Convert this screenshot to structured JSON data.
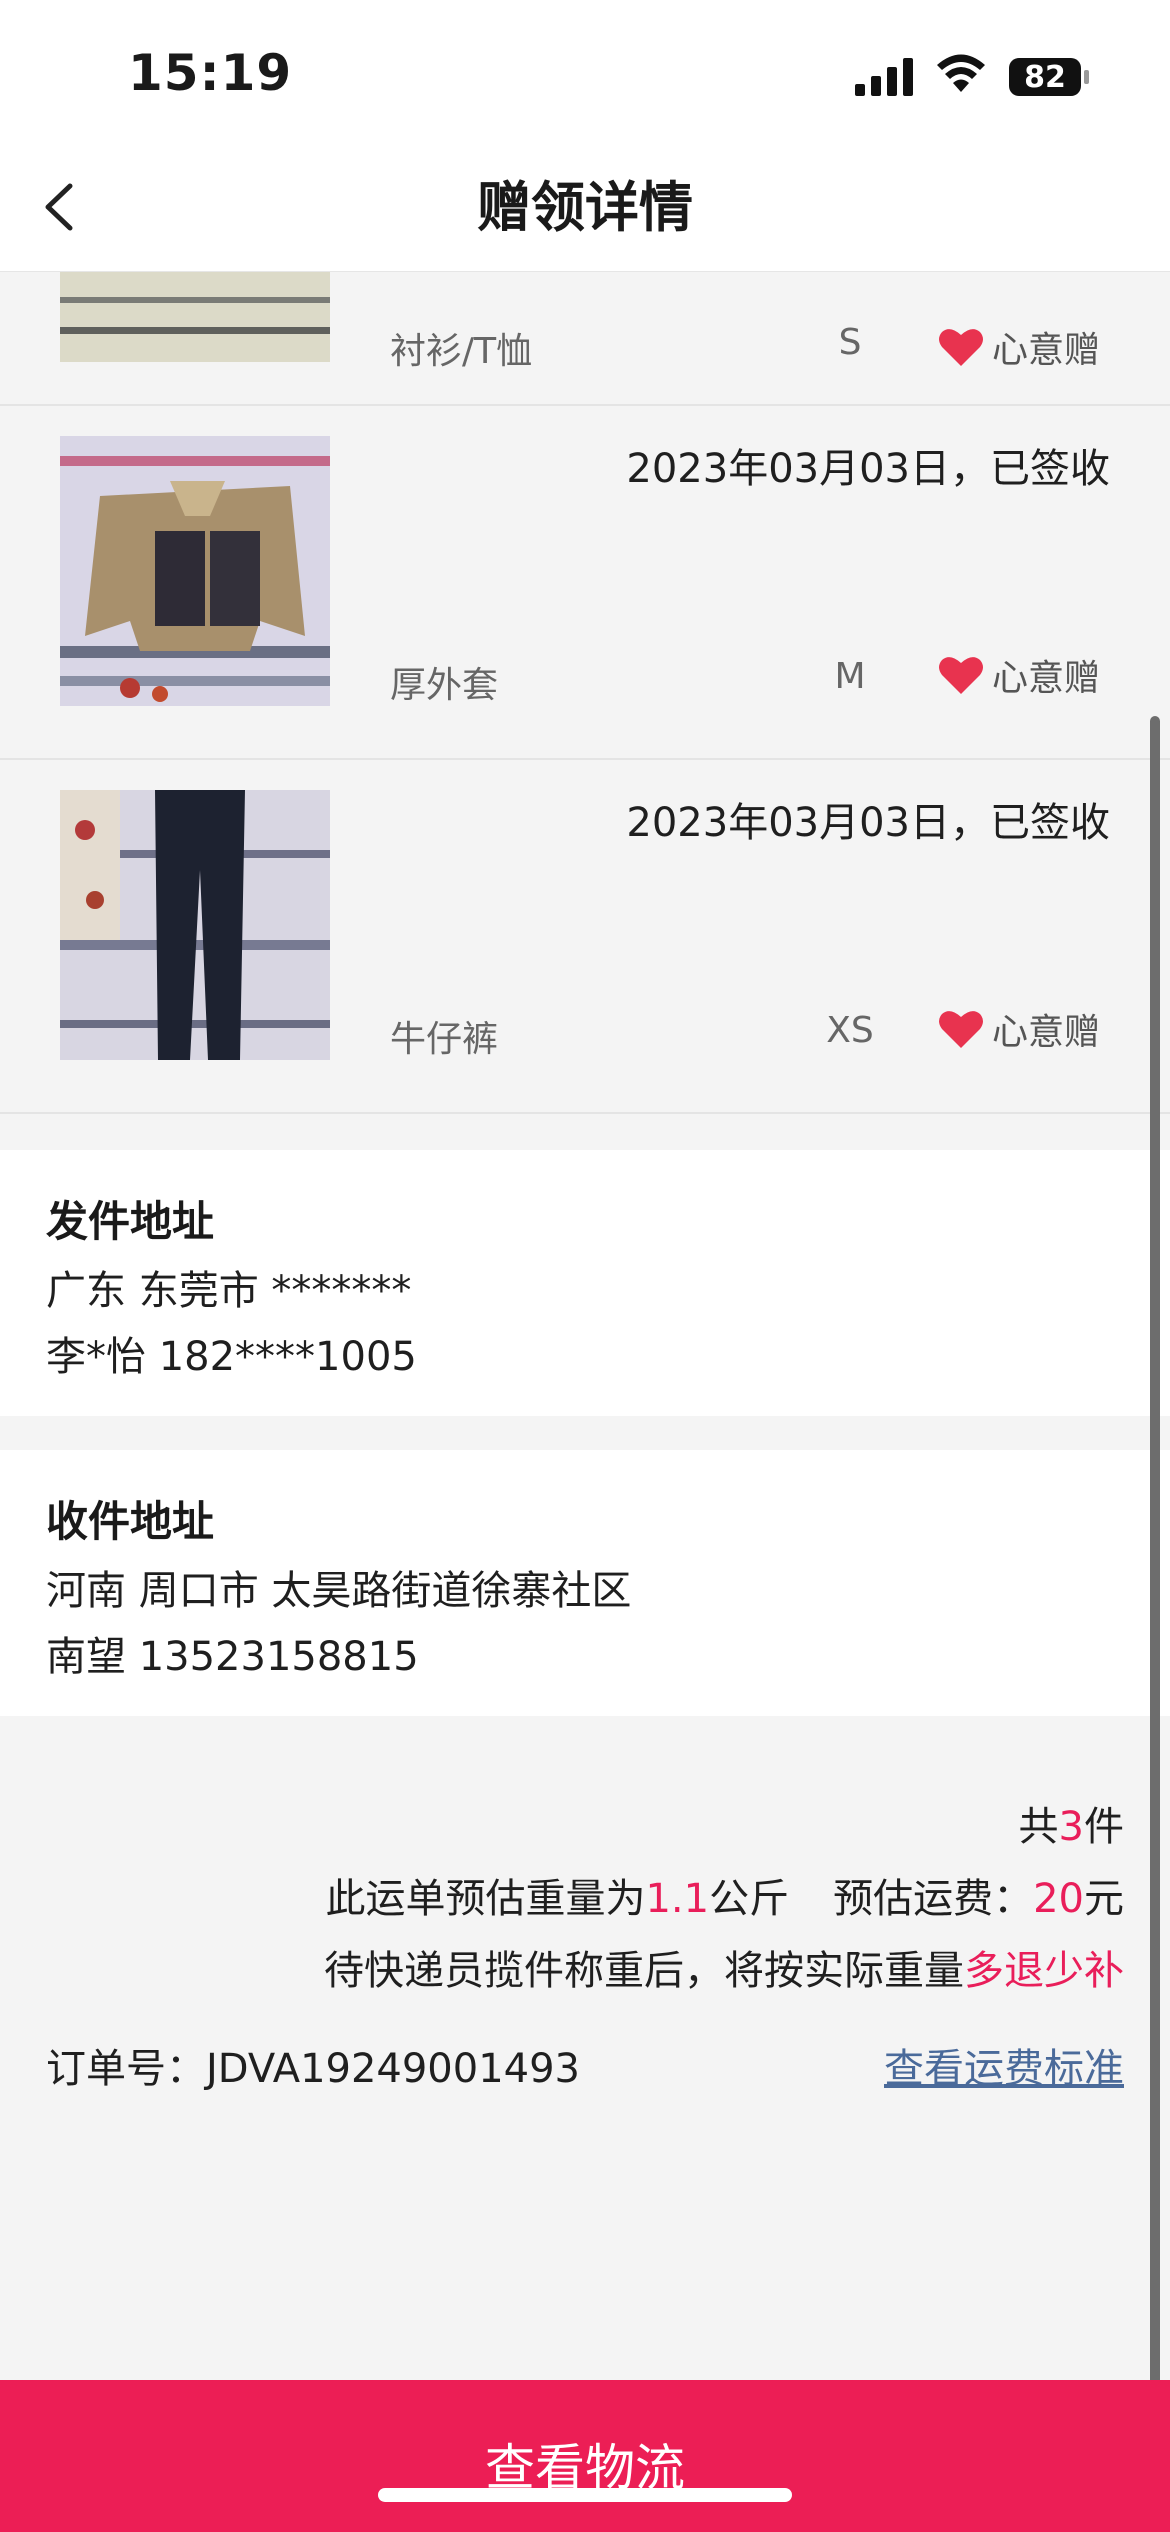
{
  "status_bar": {
    "time": "15:19",
    "battery": "82"
  },
  "nav": {
    "title": "赠领详情"
  },
  "items": [
    {
      "date": "",
      "name": "衬衫/T恤",
      "size": "S",
      "tag": "心意赠"
    },
    {
      "date": "2023年03月03日，已签收",
      "name": "厚外套",
      "size": "M",
      "tag": "心意赠"
    },
    {
      "date": "2023年03月03日，已签收",
      "name": "牛仔裤",
      "size": "XS",
      "tag": "心意赠"
    }
  ],
  "sender": {
    "title": "发件地址",
    "address": "广东 东莞市 *******",
    "contact": "李*怡 182****1005"
  },
  "receiver": {
    "title": "收件地址",
    "address": "河南 周口市 太昊路街道徐寨社区",
    "contact": "南望 13523158815"
  },
  "summary": {
    "count_prefix": "共",
    "count": "3",
    "count_suffix": "件",
    "weight_prefix": "此运单预估重量为",
    "weight": "1.1",
    "weight_unit": "公斤",
    "fee_label": "预估运费：",
    "fee": "20",
    "fee_unit": "元",
    "note_prefix": "待快递员揽件称重后，将按实际重量",
    "note_highlight": "多退少补",
    "order_label": "订单号：",
    "order_no": "JDVA19249001493",
    "fee_link": "查看运费标准"
  },
  "bottom_button": {
    "label": "查看物流"
  },
  "colors": {
    "accent": "#ec1e55",
    "link": "#4a6a9a",
    "heart": "#e8334f"
  }
}
